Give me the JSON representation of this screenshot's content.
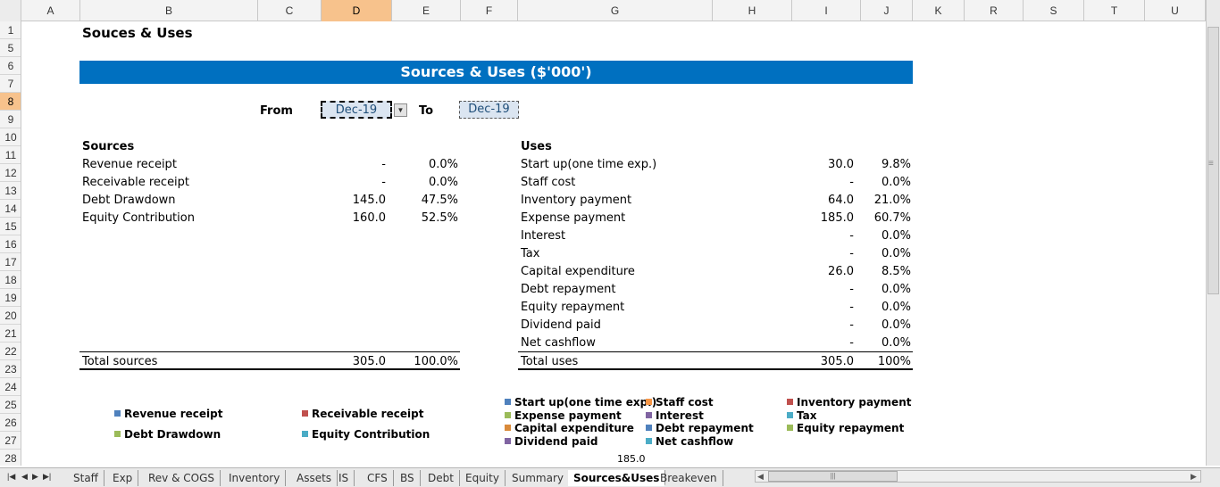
{
  "columns": [
    {
      "label": "A",
      "w": 66
    },
    {
      "label": "B",
      "w": 199
    },
    {
      "label": "C",
      "w": 71
    },
    {
      "label": "D",
      "w": 79
    },
    {
      "label": "E",
      "w": 77
    },
    {
      "label": "F",
      "w": 64
    },
    {
      "label": "G",
      "w": 218
    },
    {
      "label": "H",
      "w": 89
    },
    {
      "label": "I",
      "w": 77
    },
    {
      "label": "J",
      "w": 58
    },
    {
      "label": "K",
      "w": 58
    },
    {
      "label": "R",
      "w": 66
    },
    {
      "label": "S",
      "w": 68
    },
    {
      "label": "T",
      "w": 68
    },
    {
      "label": "U",
      "w": 68
    }
  ],
  "active_column": "D",
  "rows": [
    "1",
    "5",
    "6",
    "7",
    "8",
    "9",
    "10",
    "11",
    "12",
    "13",
    "14",
    "15",
    "16",
    "17",
    "18",
    "19",
    "20",
    "21",
    "22",
    "23",
    "24",
    "25",
    "26",
    "27",
    "28"
  ],
  "active_row": "8",
  "title": "Souces & Uses",
  "banner": "Sources & Uses ($'000')",
  "period": {
    "from_label": "From",
    "from_value": "Dec-19",
    "to_label": "To",
    "to_value": "Dec-19"
  },
  "sources": {
    "header": "Sources",
    "items": [
      {
        "label": "Revenue receipt",
        "value": "-",
        "pct": "0.0%"
      },
      {
        "label": "Receivable receipt",
        "value": "-",
        "pct": "0.0%"
      },
      {
        "label": "Debt Drawdown",
        "value": "145.0",
        "pct": "47.5%"
      },
      {
        "label": "Equity Contribution",
        "value": "160.0",
        "pct": "52.5%"
      }
    ],
    "total": {
      "label": "Total sources",
      "value": "305.0",
      "pct": "100.0%"
    }
  },
  "uses": {
    "header": "Uses",
    "items": [
      {
        "label": "Start up(one time exp.)",
        "value": "30.0",
        "pct": "9.8%"
      },
      {
        "label": "Staff cost",
        "value": "-",
        "pct": "0.0%"
      },
      {
        "label": "Inventory payment",
        "value": "64.0",
        "pct": "21.0%"
      },
      {
        "label": "Expense payment",
        "value": "185.0",
        "pct": "60.7%"
      },
      {
        "label": "Interest",
        "value": "-",
        "pct": "0.0%"
      },
      {
        "label": "Tax",
        "value": "-",
        "pct": "0.0%"
      },
      {
        "label": "Capital expenditure",
        "value": "26.0",
        "pct": "8.5%"
      },
      {
        "label": "Debt repayment",
        "value": "-",
        "pct": "0.0%"
      },
      {
        "label": "Equity repayment",
        "value": "-",
        "pct": "0.0%"
      },
      {
        "label": "Dividend paid",
        "value": "-",
        "pct": "0.0%"
      },
      {
        "label": "Net cashflow",
        "value": "-",
        "pct": "0.0%"
      }
    ],
    "total": {
      "label": "Total uses",
      "value": "305.0",
      "pct": "100%"
    }
  },
  "sources_legend": [
    {
      "label": "Revenue receipt",
      "color": "#4f81bd"
    },
    {
      "label": "Receivable receipt",
      "color": "#c0504d"
    },
    {
      "label": "Debt Drawdown",
      "color": "#9bbb59"
    },
    {
      "label": "Equity Contribution",
      "color": "#4bacc6"
    }
  ],
  "uses_legend": [
    {
      "label": "Start up(one time exp.)",
      "color": "#4f81bd"
    },
    {
      "label": "Staff cost",
      "color": "#f79646"
    },
    {
      "label": "Inventory payment",
      "color": "#c0504d"
    },
    {
      "label": "Expense payment",
      "color": "#9bbb59"
    },
    {
      "label": "Interest",
      "color": "#8064a2"
    },
    {
      "label": "Tax",
      "color": "#4bacc6"
    },
    {
      "label": "Capital expenditure",
      "color": "#d98a3a"
    },
    {
      "label": "Debt repayment",
      "color": "#4f81bd"
    },
    {
      "label": "Equity repayment",
      "color": "#9bbb59"
    },
    {
      "label": "Dividend paid",
      "color": "#8064a2"
    },
    {
      "label": "Net cashflow",
      "color": "#4bacc6"
    }
  ],
  "footer_value": "185.0",
  "tabs": [
    "Staff",
    "Exp",
    "Rev & COGS",
    "Inventory",
    "Assets",
    "IS",
    "CFS",
    "BS",
    "Debt",
    "Equity",
    "Summary",
    "Sources&Uses",
    "Breakeven"
  ],
  "active_tab": "Sources&Uses"
}
